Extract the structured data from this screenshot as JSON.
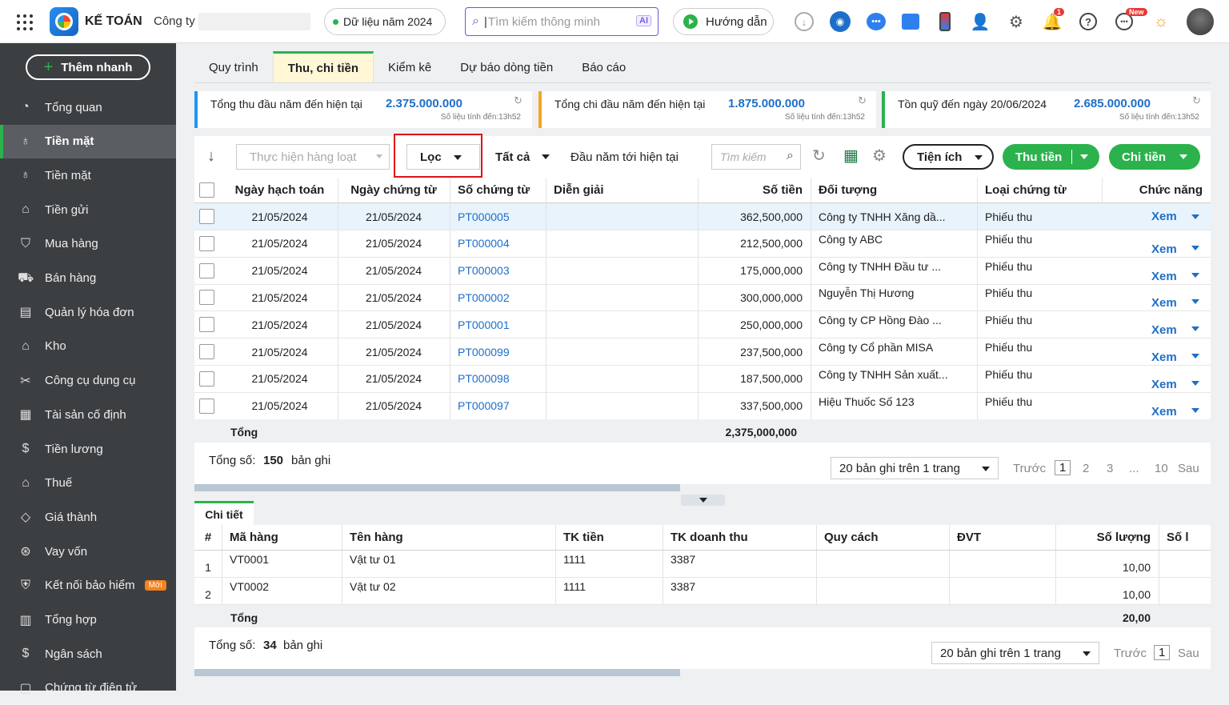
{
  "header": {
    "app_name": "KẾ TOÁN",
    "company_label": "Công ty",
    "year_pill": "Dữ liệu năm 2024",
    "search_placeholder": "Tìm kiếm thông minh",
    "ai_label": "AI",
    "guide_label": "Hướng dẫn",
    "notification_count": "1",
    "new_badge": "New"
  },
  "sidebar": {
    "quick_add": "Thêm nhanh",
    "items": [
      {
        "label": "Tổng quan",
        "icon": "dashboard-icon",
        "glyph": "◔"
      },
      {
        "label": "Tiền mặt",
        "icon": "cash-icon",
        "glyph": "♁",
        "active": true
      },
      {
        "label": "Tiền mặt",
        "icon": "cash-icon",
        "glyph": "♁"
      },
      {
        "label": "Tiền gửi",
        "icon": "bank-icon",
        "glyph": "⌂"
      },
      {
        "label": "Mua hàng",
        "icon": "purchase-bag-icon",
        "glyph": "⛉"
      },
      {
        "label": "Bán hàng",
        "icon": "cart-icon",
        "glyph": "⛟"
      },
      {
        "label": "Quản lý hóa đơn",
        "icon": "invoice-icon",
        "glyph": "▤"
      },
      {
        "label": "Kho",
        "icon": "warehouse-icon",
        "glyph": "⌂"
      },
      {
        "label": "Công cụ dụng cụ",
        "icon": "tools-icon",
        "glyph": "✂"
      },
      {
        "label": "Tài sản cố định",
        "icon": "asset-icon",
        "glyph": "▦"
      },
      {
        "label": "Tiền lương",
        "icon": "salary-icon",
        "glyph": "$"
      },
      {
        "label": "Thuế",
        "icon": "tax-icon",
        "glyph": "⌂"
      },
      {
        "label": "Giá thành",
        "icon": "price-tag-icon",
        "glyph": "◇"
      },
      {
        "label": "Vay vốn",
        "icon": "loan-icon",
        "glyph": "⊛"
      },
      {
        "label": "Kết nối bảo hiểm",
        "icon": "insurance-shield-icon",
        "glyph": "⛨",
        "badge": "Mới"
      },
      {
        "label": "Tổng hợp",
        "icon": "summary-icon",
        "glyph": "▥"
      },
      {
        "label": "Ngân sách",
        "icon": "budget-icon",
        "glyph": "$"
      },
      {
        "label": "Chứng từ điện tử",
        "icon": "e-document-icon",
        "glyph": "▢"
      }
    ]
  },
  "tabs": [
    "Quy trình",
    "Thu, chi tiền",
    "Kiểm kê",
    "Dự báo dòng tiền",
    "Báo cáo"
  ],
  "cards": [
    {
      "label": "Tổng thu đầu năm đến hiện tại",
      "value": "2.375.000.000",
      "sub": "Số liệu tính đến:13h52",
      "color": "#2196f3"
    },
    {
      "label": "Tổng chi đầu năm đến hiện tại",
      "value": "1.875.000.000",
      "sub": "Số liệu tính đến:13h52",
      "color": "#f5a623"
    },
    {
      "label": "Tồn quỹ đến ngày 20/06/2024",
      "value": "2.685.000.000",
      "sub": "Số liệu tính đến:13h52",
      "color": "#2bb24c"
    }
  ],
  "toolbar": {
    "batch": "Thực hiện hàng loạt",
    "filter": "Lọc",
    "all": "Tất cả",
    "period": "Đầu năm tới hiện tại",
    "search_placeholder": "Tìm kiếm",
    "utility": "Tiện ích",
    "receive": "Thu tiền",
    "pay": "Chi tiền"
  },
  "main_table": {
    "headers": [
      "Ngày hạch toán",
      "Ngày chứng từ",
      "Số chứng từ",
      "Diễn giải",
      "Số tiền",
      "Đối tượng",
      "Loại chứng từ",
      "Chức năng"
    ],
    "rows": [
      {
        "post_date": "21/05/2024",
        "doc_date": "21/05/2024",
        "doc_no": "PT000005",
        "desc": "",
        "amount": "362,500,000",
        "object": "Công ty TNHH Xăng dầ...",
        "type": "Phiếu thu",
        "action": "Xem"
      },
      {
        "post_date": "21/05/2024",
        "doc_date": "21/05/2024",
        "doc_no": "PT000004",
        "desc": "",
        "amount": "212,500,000",
        "object": "Công ty ABC",
        "type": "Phiếu thu",
        "action": "Xem"
      },
      {
        "post_date": "21/05/2024",
        "doc_date": "21/05/2024",
        "doc_no": "PT000003",
        "desc": "",
        "amount": "175,000,000",
        "object": "Công ty TNHH Đầu tư ...",
        "type": "Phiếu thu",
        "action": "Xem"
      },
      {
        "post_date": "21/05/2024",
        "doc_date": "21/05/2024",
        "doc_no": "PT000002",
        "desc": "",
        "amount": "300,000,000",
        "object": "Nguyễn Thị Hương",
        "type": "Phiếu thu",
        "action": "Xem"
      },
      {
        "post_date": "21/05/2024",
        "doc_date": "21/05/2024",
        "doc_no": "PT000001",
        "desc": "",
        "amount": "250,000,000",
        "object": "Công ty CP Hồng Đào ...",
        "type": "Phiếu thu",
        "action": "Xem"
      },
      {
        "post_date": "21/05/2024",
        "doc_date": "21/05/2024",
        "doc_no": "PT000099",
        "desc": "",
        "amount": "237,500,000",
        "object": "Công ty Cổ phần MISA",
        "type": "Phiếu thu",
        "action": "Xem"
      },
      {
        "post_date": "21/05/2024",
        "doc_date": "21/05/2024",
        "doc_no": "PT000098",
        "desc": "",
        "amount": "187,500,000",
        "object": "Công ty TNHH Sản xuất...",
        "type": "Phiếu thu",
        "action": "Xem"
      },
      {
        "post_date": "21/05/2024",
        "doc_date": "21/05/2024",
        "doc_no": "PT000097",
        "desc": "",
        "amount": "337,500,000",
        "object": "Hiệu Thuốc Số 123",
        "type": "Phiếu thu",
        "action": "Xem"
      }
    ],
    "total_label": "Tổng",
    "total_amount": "2,375,000,000",
    "count_label": "Tổng số:",
    "count": "150",
    "count_unit": "bản ghi",
    "page_size": "20 bản ghi trên 1 trang",
    "prev": "Trước",
    "next": "Sau",
    "pages": [
      "1",
      "2",
      "3",
      "...",
      "10"
    ]
  },
  "detail": {
    "tab": "Chi tiết",
    "headers": [
      "#",
      "Mã hàng",
      "Tên hàng",
      "TK tiền",
      "TK doanh thu",
      "Quy cách",
      "ĐVT",
      "Số lượng",
      "Số l"
    ],
    "rows": [
      {
        "no": "1",
        "code": "VT0001",
        "name": "Vật tư 01",
        "cash_acc": "1111",
        "rev_acc": "3387",
        "spec": "",
        "unit": "",
        "qty": "10,00"
      },
      {
        "no": "2",
        "code": "VT0002",
        "name": "Vật tư 02",
        "cash_acc": "1111",
        "rev_acc": "3387",
        "spec": "",
        "unit": "",
        "qty": "10,00"
      }
    ],
    "total_label": "Tổng",
    "total_qty": "20,00",
    "count_label": "Tổng số:",
    "count": "34",
    "count_unit": "bản ghi",
    "page_size": "20 bản ghi trên 1 trang",
    "prev": "Trước",
    "page": "1",
    "next": "Sau"
  }
}
